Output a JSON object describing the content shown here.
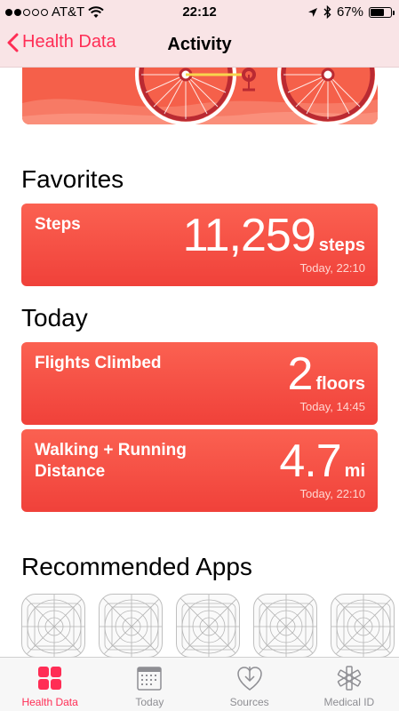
{
  "status_bar": {
    "carrier": "AT&T",
    "time": "22:12",
    "battery_percent": "67%",
    "battery_level": 0.67,
    "signal_bars_filled": 2,
    "signal_bars_total": 5
  },
  "nav": {
    "back_label": "Health Data",
    "title": "Activity"
  },
  "sections": {
    "favorites": "Favorites",
    "today": "Today",
    "recommended": "Recommended Apps"
  },
  "favorites": [
    {
      "label": "Steps",
      "value": "11,259",
      "unit": "steps",
      "time": "Today, 22:10"
    }
  ],
  "today": [
    {
      "label": "Flights Climbed",
      "value": "2",
      "unit": "floors",
      "time": "Today, 14:45"
    },
    {
      "label": "Walking + Running Distance",
      "value": "4.7",
      "unit": "mi",
      "time": "Today, 22:10"
    }
  ],
  "tabs": [
    {
      "label": "Health Data",
      "icon": "health-data-icon",
      "active": true
    },
    {
      "label": "Today",
      "icon": "calendar-icon",
      "active": false
    },
    {
      "label": "Sources",
      "icon": "sources-icon",
      "active": false
    },
    {
      "label": "Medical ID",
      "icon": "medical-id-icon",
      "active": false
    }
  ],
  "colors": {
    "accent": "#ff2d55",
    "card": "#f44c40",
    "bar_bg": "#f9e4e6"
  }
}
